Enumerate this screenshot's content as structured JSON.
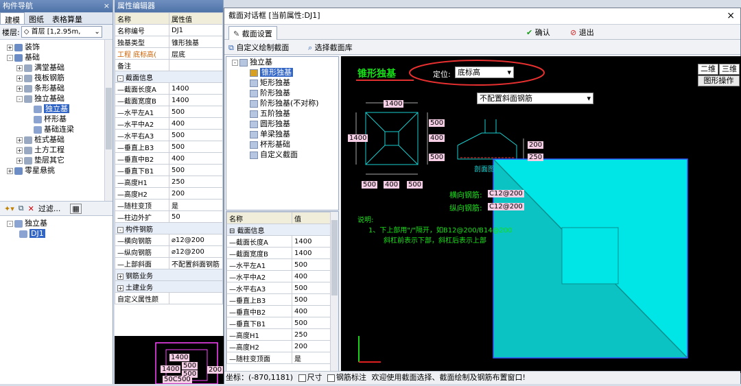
{
  "nav": {
    "title": "构件导航",
    "close": "×",
    "tabs": [
      "建模",
      "图纸",
      "表格算量"
    ],
    "floor_label": "楼层:",
    "floor_value": "首层 [1,2.95m,",
    "tree": [
      {
        "label": "装饰",
        "level": 0,
        "exp": "+"
      },
      {
        "label": "基础",
        "level": 0,
        "exp": "-"
      },
      {
        "label": "满堂基础",
        "level": 1,
        "exp": "+"
      },
      {
        "label": "筏板钢筋",
        "level": 1,
        "exp": "+"
      },
      {
        "label": "条形基础",
        "level": 1,
        "exp": "+"
      },
      {
        "label": "独立基础",
        "level": 1,
        "exp": "-"
      },
      {
        "label": "独立基",
        "level": 2,
        "exp": "",
        "selected": true
      },
      {
        "label": "杯形基",
        "level": 2,
        "exp": ""
      },
      {
        "label": "基础连梁",
        "level": 2,
        "exp": ""
      },
      {
        "label": "桩式基础",
        "level": 1,
        "exp": "+"
      },
      {
        "label": "土方工程",
        "level": 1,
        "exp": "+"
      },
      {
        "label": "垫层其它",
        "level": 1,
        "exp": "+"
      },
      {
        "label": "零星悬挑",
        "level": 0,
        "exp": "+"
      }
    ],
    "toolbar_filter": "过滤...",
    "tree2": [
      {
        "label": "独立基",
        "level": 0
      },
      {
        "label": "DJ1",
        "level": 1,
        "selected": true
      }
    ]
  },
  "prop": {
    "title": "属性编辑器",
    "col_name": "名称",
    "col_value": "属性值",
    "rows": [
      {
        "name": "名称编号",
        "value": "DJ1"
      },
      {
        "name": "独基类型",
        "value": "锥形独基"
      },
      {
        "name": "工程 底标高(",
        "value": "层底",
        "hl": true
      },
      {
        "name": "备注",
        "value": ""
      },
      {
        "section": "截面信息",
        "exp": "-"
      },
      {
        "name": "—截面长度A",
        "value": "1400"
      },
      {
        "name": "—截面宽度B",
        "value": "1400"
      },
      {
        "name": "—水平左A1",
        "value": "500"
      },
      {
        "name": "—水平中A2",
        "value": "400"
      },
      {
        "name": "—水平右A3",
        "value": "500"
      },
      {
        "name": "—垂直上B3",
        "value": "500"
      },
      {
        "name": "—垂直中B2",
        "value": "400"
      },
      {
        "name": "—垂直下B1",
        "value": "500"
      },
      {
        "name": "—高度H1",
        "value": "250"
      },
      {
        "name": "—高度H2",
        "value": "200"
      },
      {
        "name": "—随柱变顶",
        "value": "是"
      },
      {
        "name": "—柱边外扩",
        "value": "50"
      },
      {
        "section": "构件钢筋",
        "exp": "-"
      },
      {
        "name": "—横向钢筋",
        "value": "⌀12@200"
      },
      {
        "name": "—纵向钢筋",
        "value": "⌀12@200"
      },
      {
        "name": "—上部斜面",
        "value": "不配置斜面钢筋"
      },
      {
        "section": "钢筋业务",
        "exp": "+"
      },
      {
        "section": "土建业务",
        "exp": "+"
      },
      {
        "name": "自定义属性颜",
        "value": ""
      }
    ]
  },
  "dialog": {
    "title": "截面对话框 [当前属性:DJ1]",
    "close": "×",
    "tab_section": "截面设置",
    "confirm": "确认",
    "exit": "退出",
    "custom_draw": "自定义绘制截面",
    "select_lib": "选择截面库",
    "section_tree": [
      {
        "label": "独立基",
        "level": 0
      },
      {
        "label": "锥形独基",
        "level": 1,
        "selected": true
      },
      {
        "label": "矩形独基",
        "level": 1
      },
      {
        "label": "阶形独基",
        "level": 1
      },
      {
        "label": "阶形独基(不对称)",
        "level": 1
      },
      {
        "label": "五阶独基",
        "level": 1
      },
      {
        "label": "圆形独基",
        "level": 1
      },
      {
        "label": "单梁独基",
        "level": 1
      },
      {
        "label": "杯形基础",
        "level": 1
      },
      {
        "label": "自定义截面",
        "level": 1
      }
    ],
    "props_col_name": "名称",
    "props_col_value": "值",
    "props_rows": [
      {
        "section": "截面信息"
      },
      {
        "name": "—截面长度A",
        "value": "1400"
      },
      {
        "name": "—截面宽度B",
        "value": "1400"
      },
      {
        "name": "—水平左A1",
        "value": "500"
      },
      {
        "name": "—水平中A2",
        "value": "400"
      },
      {
        "name": "—水平右A3",
        "value": "500"
      },
      {
        "name": "—垂直上B3",
        "value": "500"
      },
      {
        "name": "—垂直中B2",
        "value": "400"
      },
      {
        "name": "—垂直下B1",
        "value": "500"
      },
      {
        "name": "—高度H1",
        "value": "250"
      },
      {
        "name": "—高度H2",
        "value": "200"
      },
      {
        "name": "—随柱变顶面",
        "value": "是"
      }
    ],
    "canvas": {
      "heading": "锥形独基",
      "position_label": "定位:",
      "position_value": "底标高",
      "slope_value": "不配置斜面钢筋",
      "btn_2d": "二维",
      "btn_3d": "三维",
      "btn_shape_op": "图形操作",
      "plan_top": "1400",
      "plan_left": "1400",
      "plan_right": [
        "500",
        "400",
        "500"
      ],
      "plan_bottom": [
        "500",
        "400",
        "500"
      ],
      "section_right": [
        "200",
        "250"
      ],
      "section_label": "剖面图",
      "rebar_h_label": "横向钢筋:",
      "rebar_h_value": "C12@200",
      "rebar_v_label": "纵向钢筋:",
      "rebar_v_value": "C12@200",
      "note_title": "说明:",
      "note_1": "1、下上部用\"/\"隔开，如B12@200/B14@200",
      "note_2": "斜杠前表示下部，斜杠后表示上部"
    },
    "status": {
      "coord": "坐标：(-870,1181)",
      "chk_size": "尺寸",
      "chk_rebar": "钢筋标注",
      "message": "欢迎使用截面选择、截面绘制及钢筋布置窗口!"
    }
  },
  "thumb": {
    "labels": [
      "1400",
      "500",
      "1400",
      "500",
      "200",
      "50C500"
    ]
  },
  "colors": {
    "cyan": "#00e5e5",
    "accent_blue": "#3165c6"
  }
}
